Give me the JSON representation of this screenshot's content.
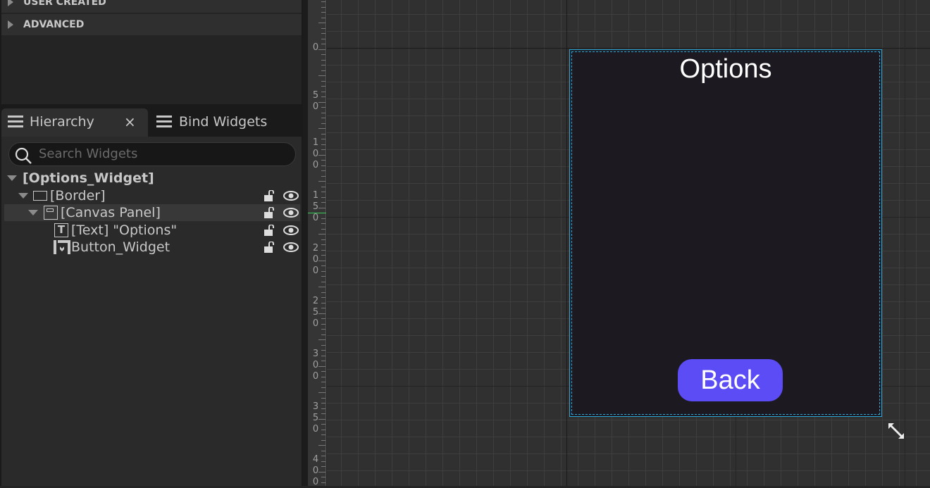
{
  "palette": {
    "categories": [
      {
        "label": "USER CREATED"
      },
      {
        "label": "ADVANCED"
      }
    ]
  },
  "tabs": [
    {
      "label": "Hierarchy",
      "close": "×",
      "active": true
    },
    {
      "label": "Bind Widgets",
      "active": false
    }
  ],
  "search": {
    "placeholder": "Search Widgets"
  },
  "tree": [
    {
      "label": "[Options_Widget]",
      "icon": "none",
      "expanded": true
    },
    {
      "label": "[Border]",
      "icon": "border-icon",
      "expanded": true
    },
    {
      "label": "[Canvas Panel]",
      "icon": "canvas-panel-icon",
      "expanded": true,
      "selected": true
    },
    {
      "label": "[Text] \"Options\"",
      "icon": "text-icon"
    },
    {
      "label": "Button_Widget",
      "icon": "user-widget-icon"
    }
  ],
  "ruler": {
    "labels": [
      "0",
      "0",
      "50",
      "100",
      "150",
      "200",
      "250",
      "300",
      "350",
      "400"
    ]
  },
  "designer": {
    "title": "Options",
    "back_label": "Back",
    "accent": "#5b4cf5",
    "selection": "#29a8d8"
  }
}
